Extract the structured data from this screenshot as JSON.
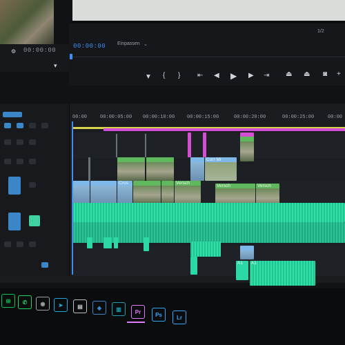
{
  "program": {
    "timecode": "00:00:00",
    "fit_select": "Einpassen",
    "zoom_value": "1/2"
  },
  "source": {
    "timecode": "00:00:00"
  },
  "ruler": {
    "ticks": [
      "00:00",
      "00:00:05:00",
      "00:00:10:00",
      "00:00:15:00",
      "00:00:20:00",
      "00:00:25:00",
      "00:00"
    ]
  },
  "clips": {
    "corr_label": "Corr Mi",
    "cross_label": "Cros",
    "versch_label_1": "Versch",
    "versch_label_2": "Versch",
    "versch_label_3": "Versch",
    "audio_label_1": "A1",
    "audio_label_2": "A1"
  },
  "taskbar": {
    "apps": [
      {
        "name": "windows",
        "glyph": "⊞",
        "color": "#00c853"
      },
      {
        "name": "whatsapp",
        "glyph": "✆",
        "color": "#25d366"
      },
      {
        "name": "chrome",
        "glyph": "◉",
        "color": "#9aa0a6"
      },
      {
        "name": "telegram",
        "glyph": "➤",
        "color": "#2aa3e0"
      },
      {
        "name": "files",
        "glyph": "▤",
        "color": "#c0c4ca"
      },
      {
        "name": "creative-cloud",
        "glyph": "◆",
        "color": "#3a86c8"
      },
      {
        "name": "media",
        "glyph": "▥",
        "color": "#17a2b8"
      },
      {
        "name": "premiere",
        "glyph": "Pr",
        "color": "#e07cff"
      },
      {
        "name": "photoshop",
        "glyph": "Ps",
        "color": "#31a8ff"
      },
      {
        "name": "lightroom",
        "glyph": "Lr",
        "color": "#31a8ff"
      }
    ]
  },
  "colors": {
    "accent": "#3f8ef0",
    "video_clip": "#5fb95c",
    "audio_clip": "#2bd8a6",
    "marker": "#d14ad8",
    "workarea": "#d8d34a"
  }
}
